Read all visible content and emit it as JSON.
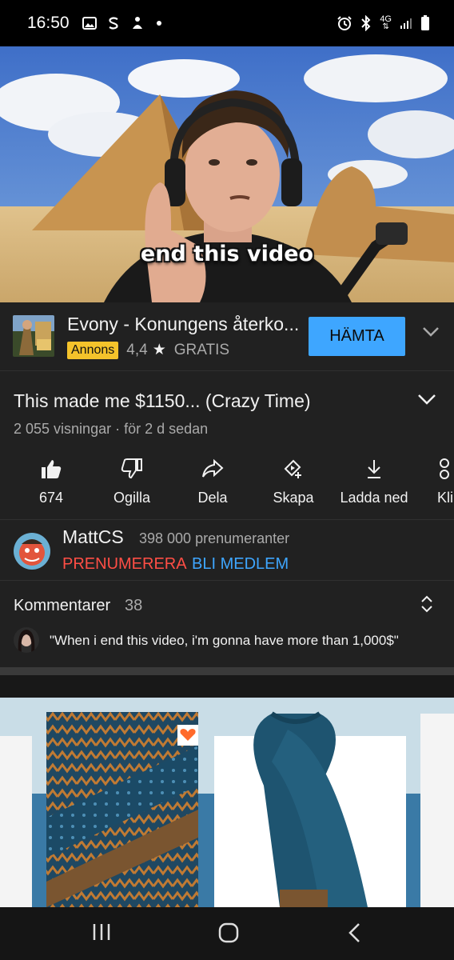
{
  "status_bar": {
    "time": "16:50",
    "left_icons": [
      "gallery-icon",
      "s-icon",
      "figure-icon",
      "dot-icon"
    ],
    "right_icons": [
      "alarm-icon",
      "bluetooth-icon",
      "4g-icon",
      "signal-icon",
      "battery-icon"
    ],
    "network": "4G"
  },
  "video": {
    "caption": "end this video"
  },
  "ad": {
    "title": "Evony - Konungens återko...",
    "badge": "Annons",
    "rating": "4,4",
    "price": "GRATIS",
    "cta": "HÄMTA",
    "accent": "#3ea6ff",
    "badge_color": "#f4c32b"
  },
  "video_info": {
    "title": "This made me $1150... (Crazy Time)",
    "meta": "2 055 visningar · för 2 d sedan"
  },
  "actions": [
    {
      "icon": "thumbs-up-icon",
      "label": "674"
    },
    {
      "icon": "thumbs-down-icon",
      "label": "Ogilla"
    },
    {
      "icon": "share-icon",
      "label": "Dela"
    },
    {
      "icon": "create-icon",
      "label": "Skapa"
    },
    {
      "icon": "download-icon",
      "label": "Ladda ned"
    },
    {
      "icon": "clip-icon",
      "label": "Kli"
    }
  ],
  "channel": {
    "name": "MattCS",
    "subscribers": "398 000 prenumeranter",
    "subscribe": "PRENUMERERA",
    "member": "BLI MEDLEM",
    "subscribe_color": "#ff4e45"
  },
  "comments": {
    "title": "Kommentarer",
    "count": "38",
    "top_comment": "\"When i end this video, i'm gonna have more than 1,000$\""
  },
  "nav": {
    "buttons": [
      "recents-icon",
      "home-icon",
      "back-icon"
    ]
  }
}
